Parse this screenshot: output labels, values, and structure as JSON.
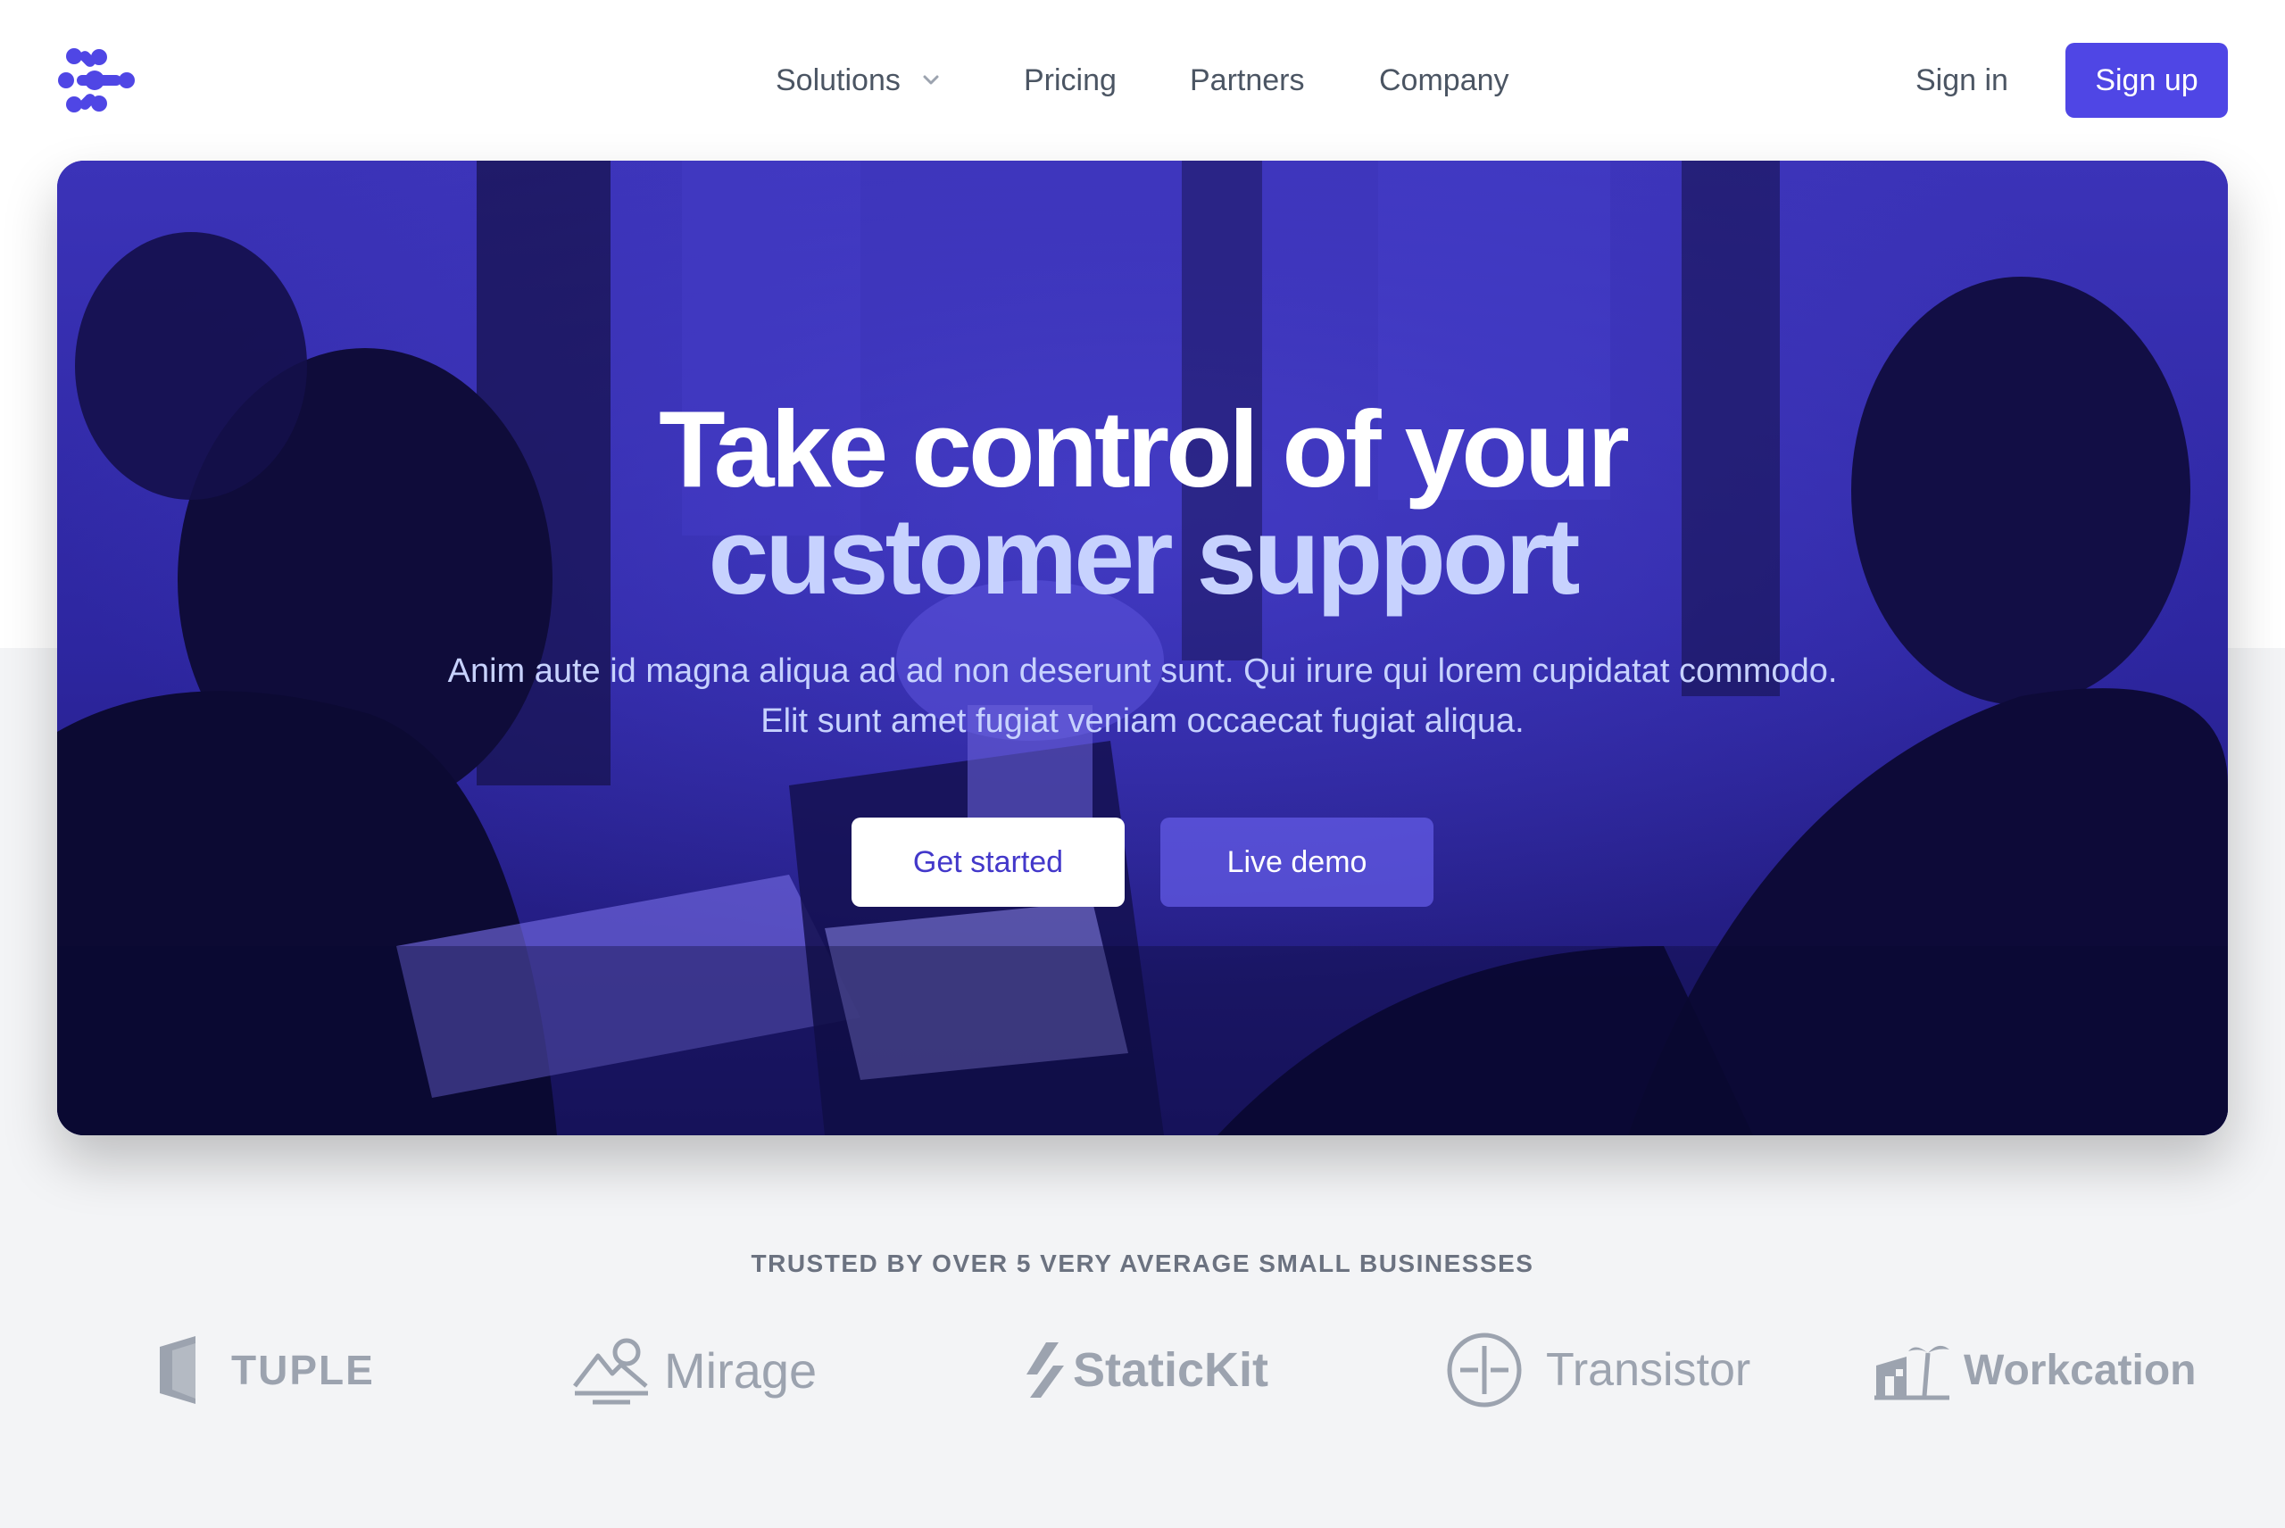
{
  "colors": {
    "brand": "#4f46e5",
    "brand_dark": "#4338ca",
    "hero_tint": "#2f28a8",
    "accent_light": "#c7d2fe",
    "logo_gray": "#9ca3af"
  },
  "header": {
    "nav": [
      {
        "label": "Solutions",
        "has_dropdown": true,
        "icon": "chevron-down-icon"
      },
      {
        "label": "Pricing"
      },
      {
        "label": "Partners"
      },
      {
        "label": "Company"
      }
    ],
    "sign_in": "Sign in",
    "sign_up": "Sign up"
  },
  "hero": {
    "title_line1": "Take control of your",
    "title_line2": "customer support",
    "subtitle": "Anim aute id magna aliqua ad ad non deserunt sunt. Qui irure qui lorem cupidatat commodo. Elit sunt amet fugiat veniam occaecat fugiat aliqua.",
    "primary_cta": "Get started",
    "secondary_cta": "Live demo"
  },
  "trusted": {
    "heading": "TRUSTED BY OVER 5 VERY AVERAGE SMALL BUSINESSES",
    "logos": [
      {
        "name": "TUPLE",
        "icon": "tuple-logo-icon"
      },
      {
        "name": "Mirage",
        "icon": "mirage-logo-icon"
      },
      {
        "name": "StaticKit",
        "icon": "statickit-logo-icon"
      },
      {
        "name": "Transistor",
        "icon": "transistor-logo-icon"
      },
      {
        "name": "Workcation",
        "icon": "workcation-logo-icon"
      }
    ]
  }
}
